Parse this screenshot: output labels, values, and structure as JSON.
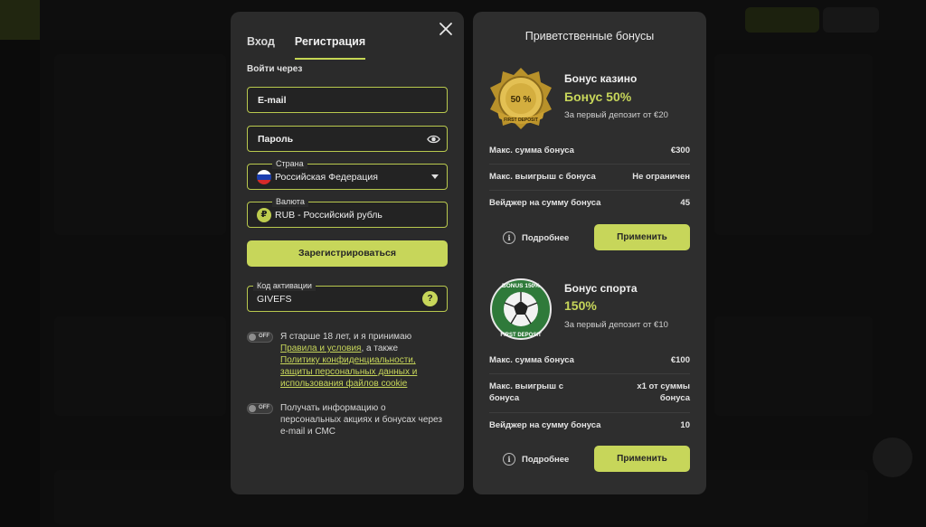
{
  "colors": {
    "accent": "#c7d65a",
    "panel": "#2b2b2b",
    "field_border": "#b9c94e"
  },
  "auth": {
    "tabs": [
      {
        "label": "Вход",
        "active": false
      },
      {
        "label": "Регистрация",
        "active": true
      }
    ],
    "login_via_label": "Войти через",
    "email_placeholder": "E-mail",
    "password_placeholder": "Пароль",
    "country": {
      "legend": "Страна",
      "value": "Российская Федерация"
    },
    "currency": {
      "legend": "Валюта",
      "value": "RUB - Российский рубль",
      "symbol": "₽"
    },
    "register_label": "Зарегистрироваться",
    "activation": {
      "legend": "Код активации",
      "value": "GIVEFS",
      "help": "?"
    },
    "consent_age": {
      "toggle": "OFF",
      "text_before": "Я старше 18 лет, и я принимаю",
      "link_rules": "Правила и условия",
      "text_middle": ", а также",
      "link_privacy": "Политику конфиденциальности, защиты персональных данных и использования файлов cookie"
    },
    "consent_promo": {
      "toggle": "OFF",
      "text": "Получать информацию о персональных акциях и бонусах через e-mail и СМС"
    }
  },
  "bonuses": {
    "title": "Приветственные бонусы",
    "items": [
      {
        "badge_text": "50 %",
        "badge_ribbon": "FIRST DEPOSIT",
        "name": "Бонус казино",
        "value": "Бонус 50%",
        "sub": "За первый депозит от €20",
        "rows": [
          {
            "label": "Макс. сумма бонуса",
            "value": "€300"
          },
          {
            "label": "Макс. выигрыш с бонуса",
            "value": "Не ограничен"
          },
          {
            "label": "Вейджер на сумму бонуса",
            "value": "45"
          }
        ],
        "more_label": "Подробнее",
        "apply_label": "Применить"
      },
      {
        "badge_text": "BONUS 150%",
        "badge_ribbon": "FIRST DEPOSIT",
        "name": "Бонус спорта",
        "value": "150%",
        "sub": "За первый депозит от €10",
        "rows": [
          {
            "label": "Макс. сумма бонуса",
            "value": "€100"
          },
          {
            "label": "Макс. выигрыш с бонуса",
            "value": "x1 от суммы бонуса"
          },
          {
            "label": "Вейджер на сумму бонуса",
            "value": "10"
          }
        ],
        "more_label": "Подробнее",
        "apply_label": "Применить"
      }
    ]
  }
}
